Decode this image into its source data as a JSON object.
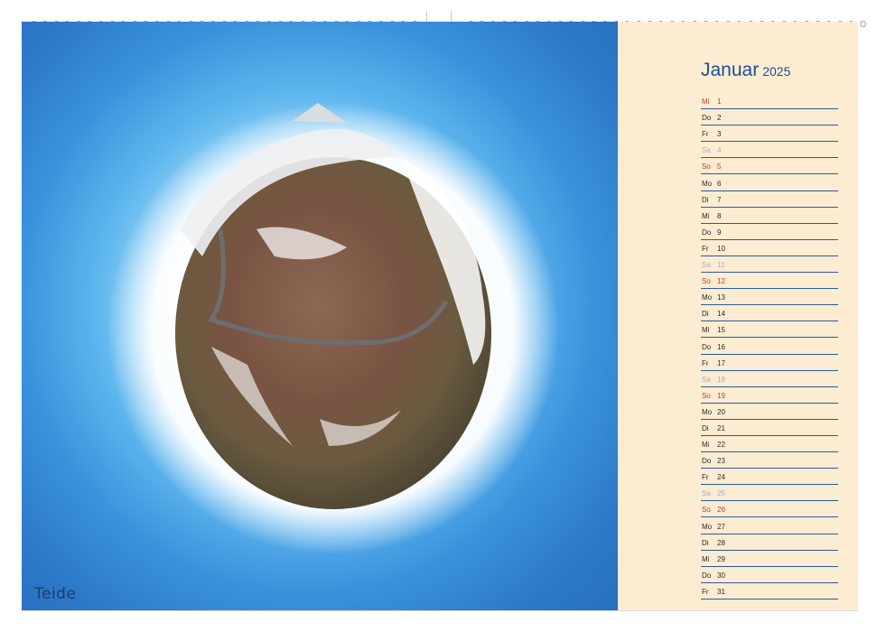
{
  "photo": {
    "caption": "Teide"
  },
  "calendar": {
    "month": "Januar",
    "year": "2025",
    "days": [
      {
        "wd": "Mi",
        "d": "1",
        "type": "holiday"
      },
      {
        "wd": "Do",
        "d": "2",
        "type": "weekday"
      },
      {
        "wd": "Fr",
        "d": "3",
        "type": "weekday"
      },
      {
        "wd": "Sa",
        "d": "4",
        "type": "saturday"
      },
      {
        "wd": "So",
        "d": "5",
        "type": "sunday"
      },
      {
        "wd": "Mo",
        "d": "6",
        "type": "weekday"
      },
      {
        "wd": "Di",
        "d": "7",
        "type": "weekday"
      },
      {
        "wd": "Mi",
        "d": "8",
        "type": "weekday"
      },
      {
        "wd": "Do",
        "d": "9",
        "type": "weekday"
      },
      {
        "wd": "Fr",
        "d": "10",
        "type": "weekday"
      },
      {
        "wd": "Sa",
        "d": "11",
        "type": "saturday"
      },
      {
        "wd": "So",
        "d": "12",
        "type": "sunday"
      },
      {
        "wd": "Mo",
        "d": "13",
        "type": "weekday"
      },
      {
        "wd": "Di",
        "d": "14",
        "type": "weekday"
      },
      {
        "wd": "Mi",
        "d": "15",
        "type": "weekday"
      },
      {
        "wd": "Do",
        "d": "16",
        "type": "weekday"
      },
      {
        "wd": "Fr",
        "d": "17",
        "type": "weekday"
      },
      {
        "wd": "Sa",
        "d": "18",
        "type": "saturday"
      },
      {
        "wd": "So",
        "d": "19",
        "type": "sunday"
      },
      {
        "wd": "Mo",
        "d": "20",
        "type": "weekday"
      },
      {
        "wd": "Di",
        "d": "21",
        "type": "weekday"
      },
      {
        "wd": "Mi",
        "d": "22",
        "type": "weekday"
      },
      {
        "wd": "Do",
        "d": "23",
        "type": "weekday"
      },
      {
        "wd": "Fr",
        "d": "24",
        "type": "weekday"
      },
      {
        "wd": "Sa",
        "d": "25",
        "type": "saturday"
      },
      {
        "wd": "So",
        "d": "26",
        "type": "sunday"
      },
      {
        "wd": "Mo",
        "d": "27",
        "type": "weekday"
      },
      {
        "wd": "Di",
        "d": "28",
        "type": "weekday"
      },
      {
        "wd": "Mi",
        "d": "29",
        "type": "weekday"
      },
      {
        "wd": "Do",
        "d": "30",
        "type": "weekday"
      },
      {
        "wd": "Fr",
        "d": "31",
        "type": "weekday"
      }
    ]
  },
  "colors": {
    "title": "#1f4f93",
    "sunday": "#c0392b",
    "saturday": "#9ab1c7",
    "panel": "#fcecd2"
  }
}
